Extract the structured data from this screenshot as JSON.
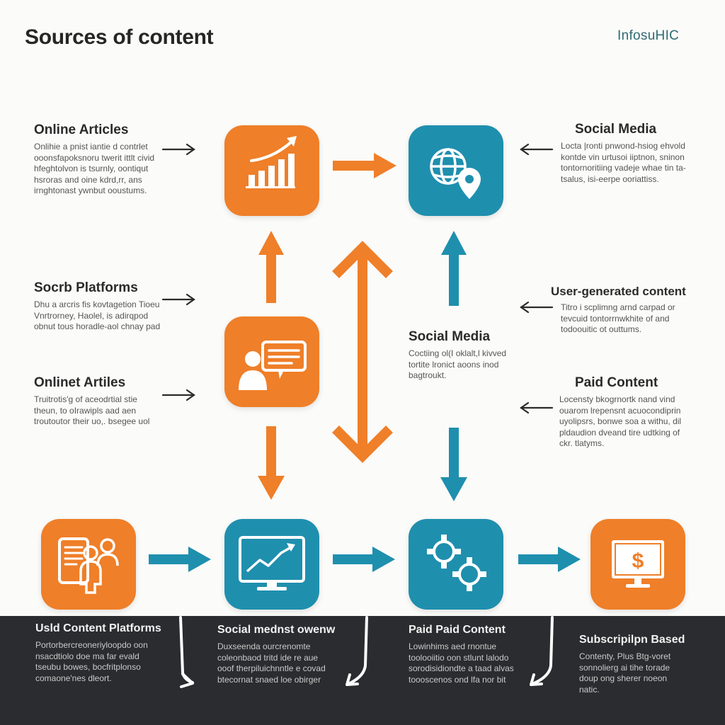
{
  "header": {
    "title": "Sources of content",
    "brand": "InfosuHIC"
  },
  "colors": {
    "orange": "#ef7f29",
    "teal": "#1f8fae",
    "dark": "#2a2c2f",
    "arrow_dark": "#2b2b2b"
  },
  "labels": {
    "online_articles": {
      "title": "Online Articles",
      "lines": [
        "Onlihie a pnist iantie d contrlet",
        "ooonsfapoksnoru twerit ittlt civid",
        "hfeghtolvon is tsurnly, oontiqut",
        "hsroras and oine kdrd,rr, ans",
        "irnghtonast ywnbut ooustums."
      ]
    },
    "social_platforms": {
      "title": "Socrb Platforms",
      "lines": [
        "Dhu a arcris fis kovtagetion Tioeu",
        "Vnrtrorney, Haolel, is adirqpod",
        "obnut tous horadle-aol chnay pad"
      ]
    },
    "onlinet_artiles": {
      "title": "Onlinet Artiles",
      "lines": [
        "Truitrotis'g of aceodrtial stie",
        "theun, to oIrawipls aad aen",
        "troutoutor their uo,. bsegee uol"
      ]
    },
    "social_media_top": {
      "title": "Social Media",
      "lines": [
        "Locta |ronti pnwond-hsiog ehvold",
        "kontde vin urtusoi iiptnon, sninon",
        "tontornoritiing vadeje whae tin ta-",
        "tsalus, isi-eerpe ooriattiss."
      ]
    },
    "user_generated": {
      "title": "User-generated content",
      "lines": [
        "Titro i scplimng arnd carpad or",
        "tevcuid tontorrnwkhite of and",
        "todoouitic ot outtums."
      ]
    },
    "social_media_center": {
      "title": "Social Media",
      "lines": [
        "Coctiing ol(I oklalt,l kivved",
        "tortite lronict aoons inod",
        "bagtroukt."
      ]
    },
    "paid_content_right": {
      "title": "Paid Content",
      "lines": [
        "Locensty bkogrnortk nand vind",
        "ouarom lrepensnt acuocondiprin",
        "uyolipsrs, bonwe soa a withu, dil",
        "pldaudion dveand tire udtking of",
        "ckr. tlatyms."
      ]
    }
  },
  "bottom": [
    {
      "title": "Usld Content Platforms",
      "lines": [
        "Portorbercreoneriyloopdo oon",
        "nsacdtiolo doe ma far evald",
        "tseubu bowes, bocfritplonso",
        "comaone'nes dleort."
      ]
    },
    {
      "title": "Social mednst owenw",
      "lines": [
        "Duxseenda ourcrenomte",
        "coleonbaod tritd ide re aue",
        "ooof therpiluichnntle e covad",
        "btecornat snaed loe obirger"
      ]
    },
    {
      "title": "Paid Paid Content",
      "lines": [
        "Lowinhims aed rnontue",
        "toolooiitio oon stlunt lalodo",
        "sorodisidiondte a taad alvas",
        "toooscenos ond lfa nor bit"
      ]
    },
    {
      "title": "Subscripilpn Based",
      "lines": [
        "Contenty, Plus Btg-voret",
        "sonnolierg ai tihe torade",
        "doup ong sherer noeon",
        "natic."
      ]
    }
  ],
  "icons": {
    "tile_1": "bar-chart-icon",
    "tile_2": "globe-pin-icon",
    "tile_3": "person-speech-icon",
    "tile_4": "document-people-icon",
    "tile_5": "monitor-trend-icon",
    "tile_6": "gears-icon",
    "tile_7": "monitor-dollar-icon"
  }
}
